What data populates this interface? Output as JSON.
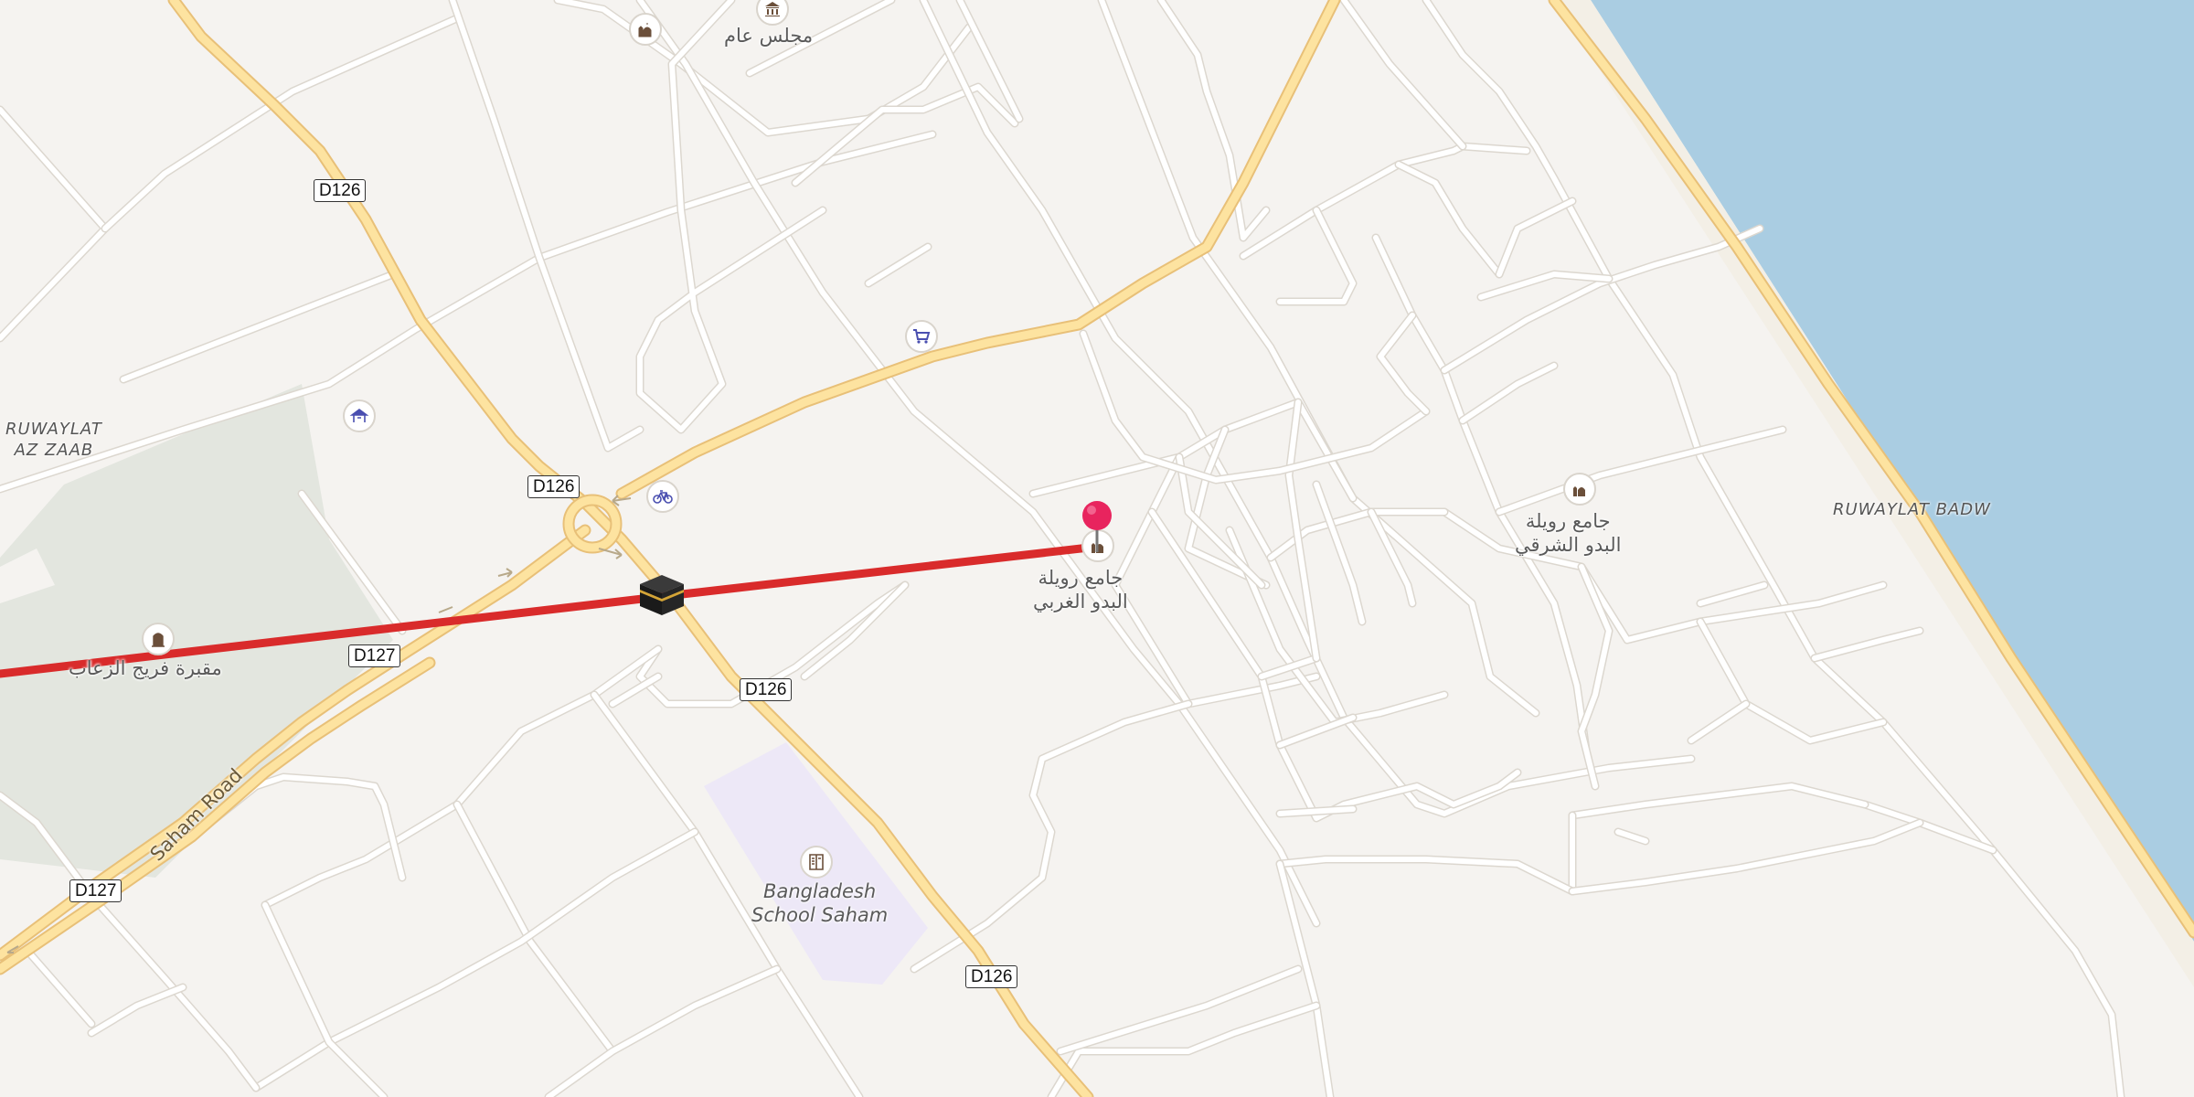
{
  "map": {
    "colors": {
      "land": "#f5f3f0",
      "water": "#aacde2",
      "park": "#e3e6df",
      "school_area": "#ede8f7",
      "major_road": "#fde3a0",
      "major_road_casing": "#e8c078",
      "minor_road": "#ffffff",
      "route_line": "#d92b2b",
      "pin": "#e8245e"
    },
    "shields": [
      {
        "id": "d126-a",
        "text": "D126"
      },
      {
        "id": "d126-b",
        "text": "D126"
      },
      {
        "id": "d126-c",
        "text": "D126"
      },
      {
        "id": "d126-d",
        "text": "D126"
      },
      {
        "id": "d127-a",
        "text": "D127"
      },
      {
        "id": "d127-b",
        "text": "D127"
      }
    ],
    "road_name": "Saham Road",
    "places": {
      "ruwaylat_az_zaab_line1": "RUWAYLAT",
      "ruwaylat_az_zaab_line2": "AZ ZAAB",
      "ruwaylat_badw": "RUWAYLAT BADW"
    },
    "labels": {
      "majlis": "مجلس عام",
      "mosque_west_line1": "جامع رويلة",
      "mosque_west_line2": "البدو الغربي",
      "mosque_east_line1": "جامع رويلة",
      "mosque_east_line2": "البدو الشرقي",
      "cemetery": "مقبرة فريج الزعاب",
      "school_line1": "Bangladesh",
      "school_line2": "School Saham"
    },
    "icons": {
      "mosque": "mosque-icon",
      "townhall": "government-building-icon",
      "shop": "shopping-cart-icon",
      "bicycle": "bicycle-icon",
      "playground": "playground-icon",
      "cemetery": "cemetery-icon",
      "school": "school-icon",
      "kaaba": "kaaba-icon",
      "pin": "map-pin-icon"
    }
  }
}
